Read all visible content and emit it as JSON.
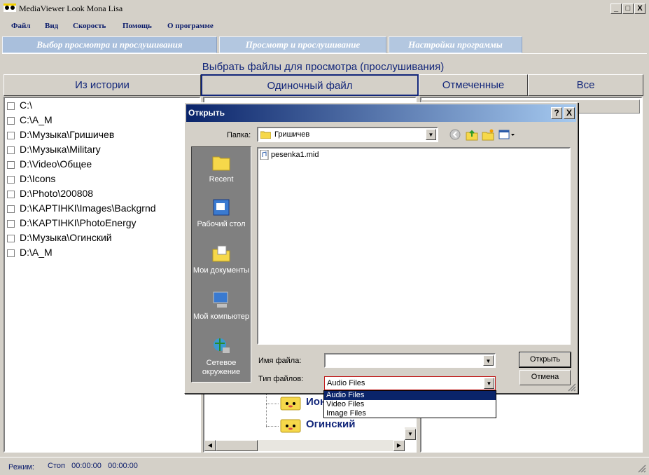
{
  "window": {
    "title": "MediaViewer Look Mona Lisa",
    "controls": [
      "_",
      "□",
      "X"
    ]
  },
  "menu": [
    "Файл",
    "Вид",
    "Скорость",
    "Помощь",
    "О программе"
  ],
  "main_tabs": [
    "Выбор просмотра и прослушивания",
    "Просмотр и прослушивание",
    "Настройки программы"
  ],
  "heading": "Выбрать файлы для просмотра (прослушивания)",
  "sub_tabs": [
    "Из истории",
    "Одиночный файл",
    "Отмеченные",
    "Все"
  ],
  "history": [
    "C:\\",
    "C:\\A_M",
    "D:\\Музыка\\Гришичев",
    "D:\\Музыка\\Military",
    "D:\\Video\\Общее",
    "D:\\Icons",
    "D:\\Photo\\200808",
    "D:\\KAPTIHKI\\Images\\Backgrnd",
    "D:\\KAPTIHKI\\PhotoEnergy",
    "D:\\Музыка\\Огинский",
    "D:\\A_M"
  ],
  "tree": {
    "items": [
      "Ион",
      "Огинский"
    ]
  },
  "status": {
    "mode_label": "Режим:",
    "values": "Стоп   00:00:00   00:00:00"
  },
  "dialog": {
    "title": "Открыть",
    "help": "?",
    "close": "X",
    "folder_label": "Папка:",
    "folder_value": "Гришичев",
    "places": [
      "Recent",
      "Рабочий стол",
      "Мои документы",
      "Мой компьютер",
      "Сетевое окружение"
    ],
    "files": [
      "pesenka1.mid"
    ],
    "filename_label": "Имя файла:",
    "filename_value": "",
    "filetype_label": "Тип файлов:",
    "filetype_value": "Audio Files",
    "filetype_options": [
      "Audio Files",
      "Video Files",
      "Image Files"
    ],
    "open_button": "Открыть",
    "cancel_button": "Отмена"
  }
}
